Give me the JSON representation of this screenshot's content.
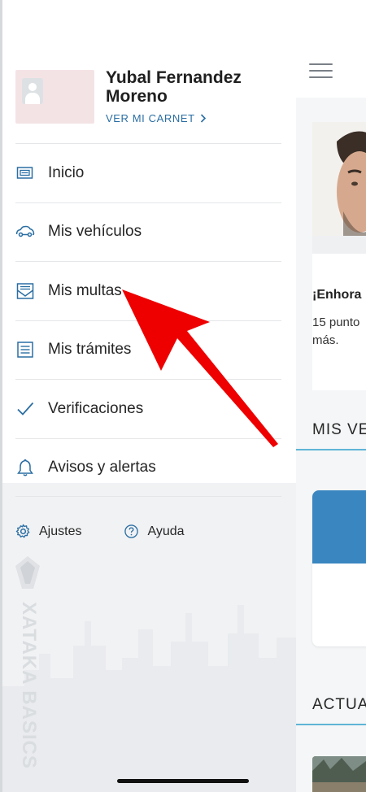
{
  "profile": {
    "name": "Yubal Fernandez Moreno",
    "carnet_link": "VER MI CARNET"
  },
  "menu": {
    "items": [
      {
        "label": "Inicio",
        "icon": "home-card-icon"
      },
      {
        "label": "Mis vehículos",
        "icon": "car-icon"
      },
      {
        "label": "Mis multas",
        "icon": "fines-envelope-icon"
      },
      {
        "label": "Mis trámites",
        "icon": "document-lines-icon"
      },
      {
        "label": "Verificaciones",
        "icon": "checkmark-icon"
      },
      {
        "label": "Avisos y alertas",
        "icon": "bell-icon"
      }
    ]
  },
  "footer_links": {
    "settings": "Ajustes",
    "help": "Ayuda"
  },
  "watermark": {
    "text": "XATAKA BASICS"
  },
  "main": {
    "greeting": "¡Enhora",
    "points_line1": "15 punto",
    "points_line2": "más.",
    "section_vehicles": "MIS VE",
    "section_news": "ACTUA"
  },
  "colors": {
    "accent": "#2a6ea3",
    "section_underline": "#5fb4d6",
    "vehicle_card": "#3a86c0",
    "annotation_arrow": "#ee0000"
  }
}
